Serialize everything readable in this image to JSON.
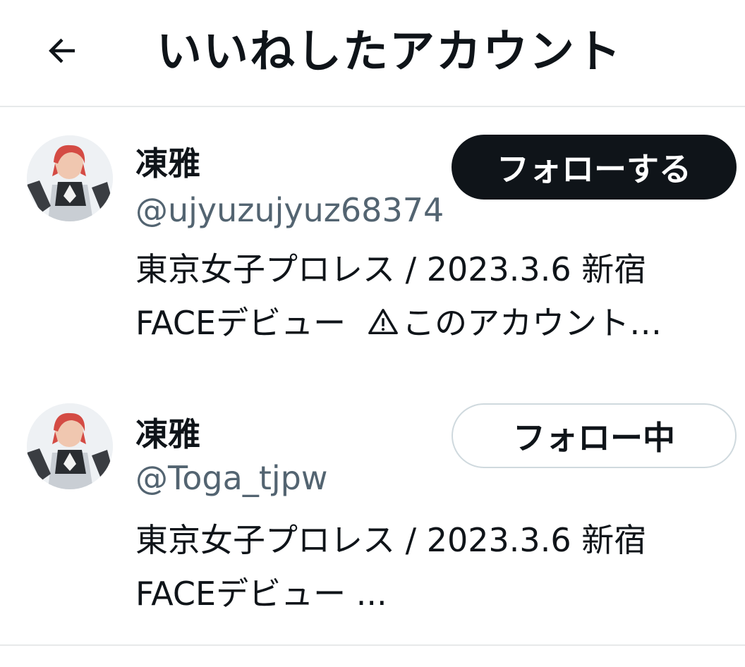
{
  "header": {
    "title": "いいねしたアカウント",
    "back_icon": "arrow-left-icon"
  },
  "users": [
    {
      "name": "凍雅",
      "handle": "@ujyuzujyuz68374",
      "bio_line1": "東京女子プロレス / 2023.3.6 新宿",
      "bio_line2_a": "FACEデビュー",
      "bio_line2_b": "このアカウント…",
      "button_label": "フォローする",
      "button_state": "not-following",
      "warning_icon": "warning-triangle-icon"
    },
    {
      "name": "凍雅",
      "handle": "@Toga_tjpw",
      "bio_line1": "東京女子プロレス / 2023.3.6 新宿",
      "bio_line2": "FACEデビュー ...",
      "button_label": "フォロー中",
      "button_state": "following"
    }
  ],
  "colors": {
    "text": "#0f1419",
    "secondary_text": "#536471",
    "follow_button_bg": "#0f1419",
    "divider": "#e7e9ea",
    "outline": "#cfd9de"
  }
}
